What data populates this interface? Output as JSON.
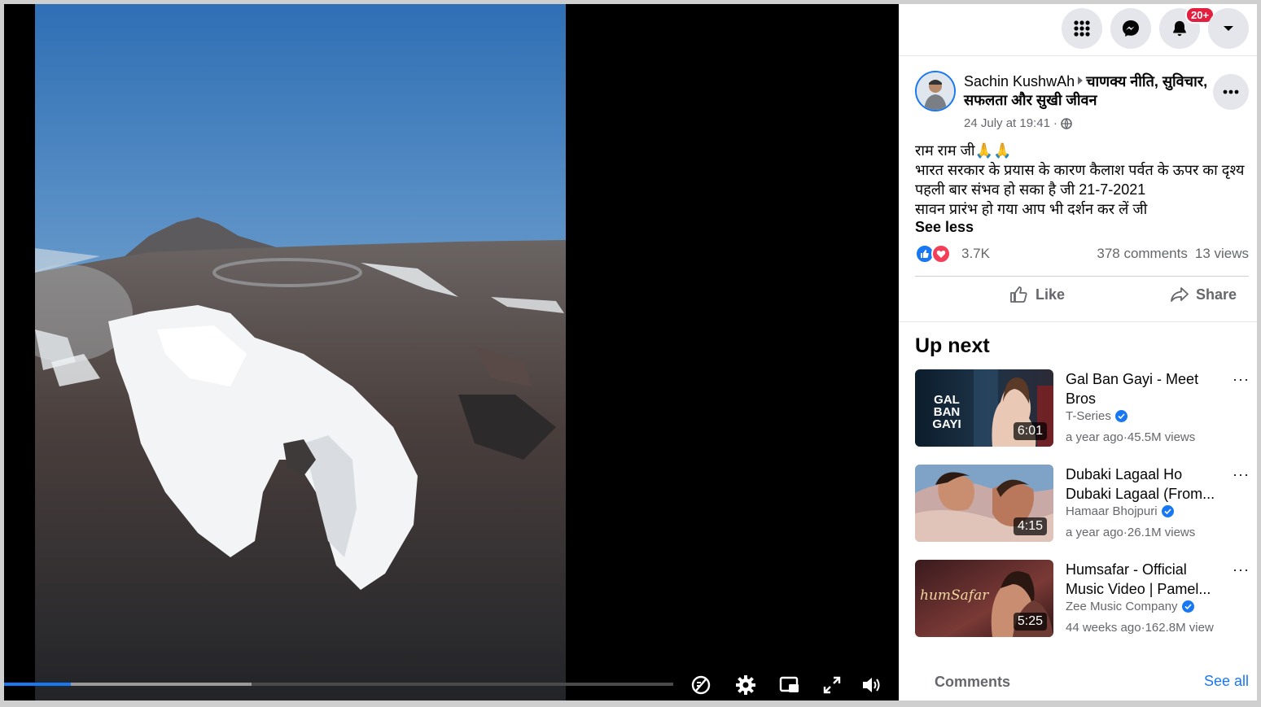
{
  "colors": {
    "accent": "#1877f2",
    "badge": "#e41e3f",
    "secondary_text": "#65676b"
  },
  "video": {
    "progress_played_fraction": 0.1,
    "progress_buffered_fraction": 0.37,
    "controls": [
      "captions-off-icon",
      "gear-icon",
      "picture-in-picture-icon",
      "fullscreen-icon",
      "volume-icon"
    ]
  },
  "topbar": {
    "buttons": [
      "menu-grid-icon",
      "messenger-icon",
      "bell-icon",
      "caret-down-icon"
    ],
    "notification_badge": "20+"
  },
  "post": {
    "author": "Sachin KushwAh",
    "group": "चाणक्य नीति, सुविचार, सफलता और सुखी जीवन",
    "timestamp": "24 July at 19:41",
    "meta_separator": "·",
    "visibility_icon": "globe-icon",
    "text_lines": [
      "राम राम जी🙏🙏",
      "भारत सरकार के प्रयास के कारण कैलाश पर्वत के ऊपर का दृश्य पहली बार संभव हो सका है जी 21-7-2021",
      "सावन प्रारंभ हो गया आप भी दर्शन कर लें जी"
    ],
    "see_less": "See less",
    "reaction_count": "3.7K",
    "comments_count": "378 comments",
    "views_count": "13 views",
    "like_label": "Like",
    "share_label": "Share"
  },
  "up_next": {
    "heading": "Up next",
    "items": [
      {
        "title": "Gal Ban Gayi - Meet Bros",
        "channel": "T-Series",
        "age": "a year ago",
        "sep": "·",
        "views": "45.5M views",
        "duration": "6:01",
        "thumb_text": "GAL BAN GAYI"
      },
      {
        "title": "Dubaki Lagaal Ho Dubaki Lagaal (From...",
        "channel": "Hamaar Bhojpuri",
        "age": "a year ago",
        "sep": "·",
        "views": "26.1M views",
        "duration": "4:15"
      },
      {
        "title": "Humsafar - Official Music Video | Pamel...",
        "channel": "Zee Music Company",
        "age": "44 weeks ago",
        "sep": "·",
        "views": "162.8M view",
        "duration": "5:25",
        "thumb_text": "humSafar"
      }
    ],
    "more_label": "···"
  },
  "comments": {
    "label": "Comments",
    "see_all": "See all"
  }
}
